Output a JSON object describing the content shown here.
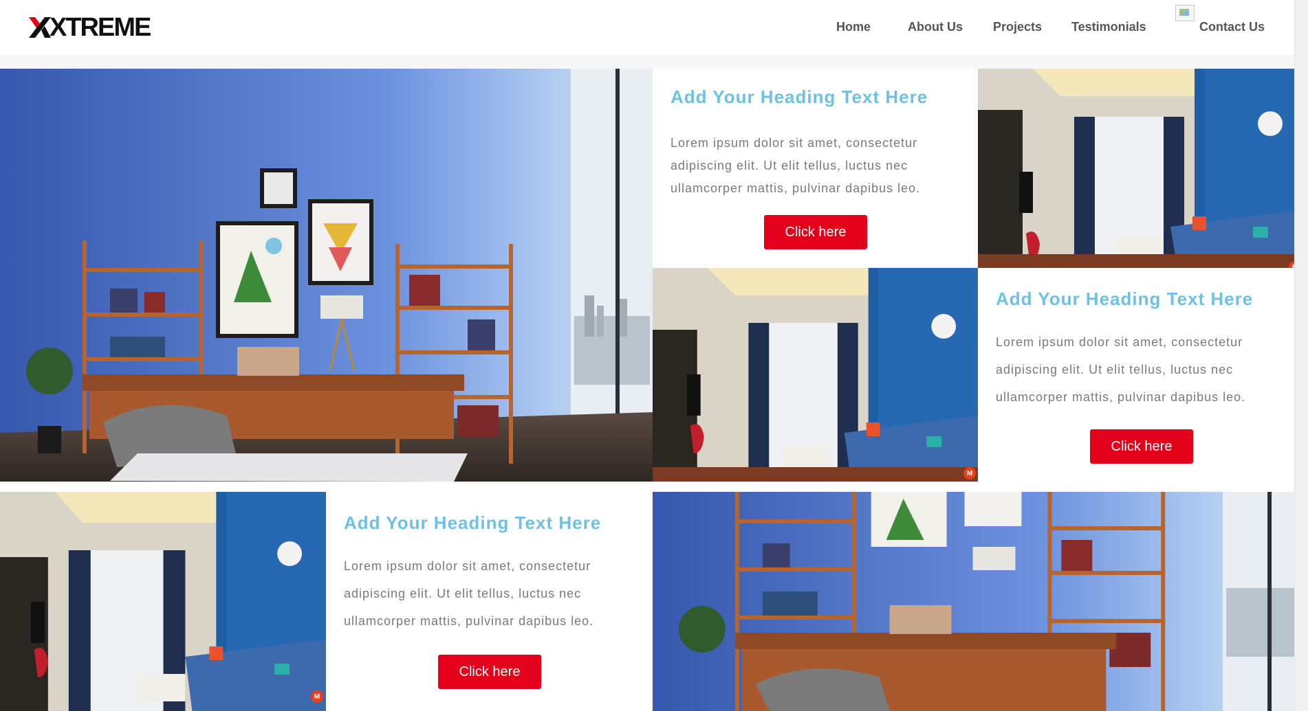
{
  "header": {
    "logo_text": "XTREME",
    "nav": [
      {
        "label": "Home"
      },
      {
        "label": "About Us"
      },
      {
        "label": "Projects"
      },
      {
        "label": "Testimonials"
      },
      {
        "label": "Contact Us"
      }
    ]
  },
  "sections": [
    {
      "heading": "Add Your Heading Text Here",
      "body": "Lorem ipsum dolor sit amet, consectetur adipiscing elit. Ut elit tellus, luctus nec ullamcorper mattis, pulvinar dapibus leo.",
      "button": "Click here"
    },
    {
      "heading": "Add Your Heading Text Here",
      "body": "Lorem ipsum dolor sit amet, consectetur adipiscing elit. Ut elit tellus, luctus nec ullamcorper mattis, pulvinar dapibus leo.",
      "button": "Click here"
    },
    {
      "heading": "Add Your Heading Text Here",
      "body": "Lorem ipsum dolor sit amet, consectetur adipiscing elit. Ut elit tellus, luctus nec ullamcorper mattis, pulvinar dapibus leo.",
      "button": "Click here"
    }
  ],
  "badge_letter": "M",
  "colors": {
    "accent_red": "#e2001a",
    "heading_blue": "#6ec1e4",
    "body_gray": "#7a7a7a",
    "nav_gray": "#555555"
  },
  "images": {
    "office": "office-room-photo",
    "living": "living-room-photo"
  }
}
